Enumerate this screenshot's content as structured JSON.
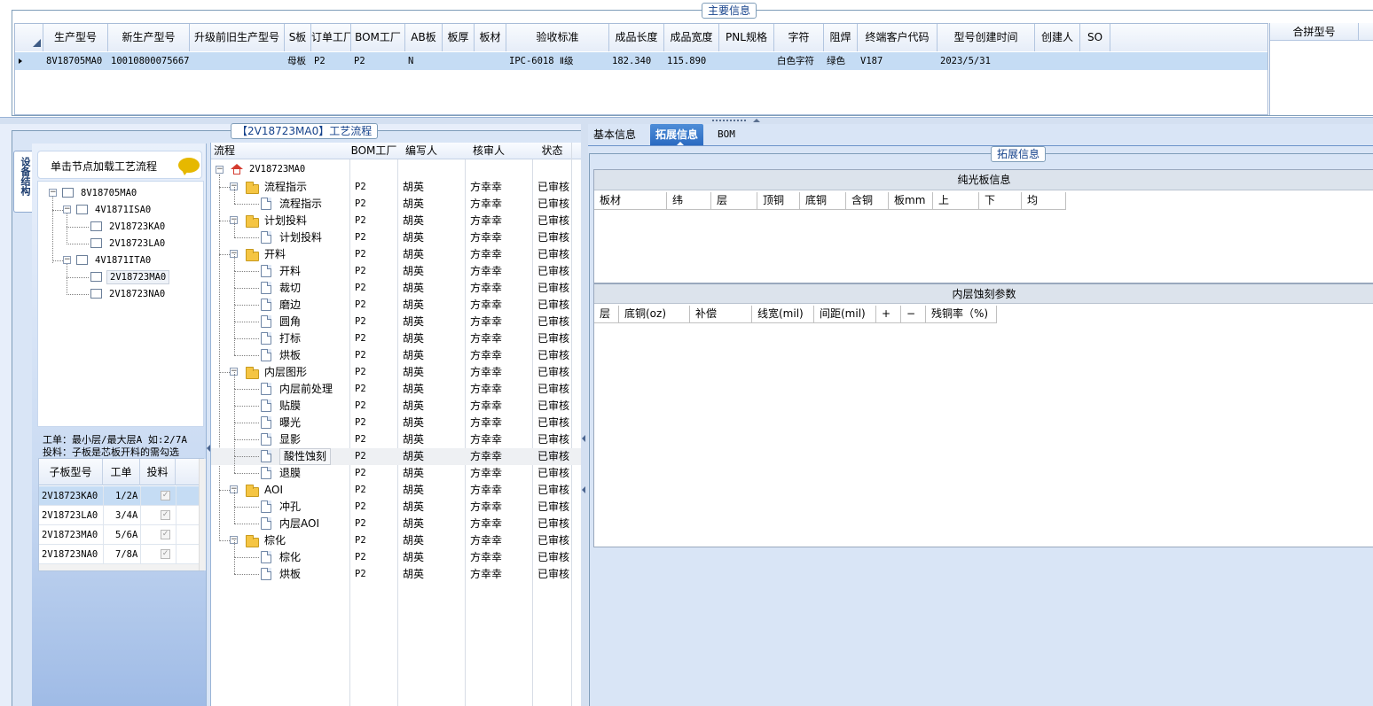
{
  "main_info": {
    "title": "主要信息",
    "columns": [
      "生产型号",
      "新生产型号",
      "升级前旧生产型号",
      "S板",
      "订单工厂",
      "BOM工厂",
      "AB板",
      "板厚",
      "板材",
      "验收标准",
      "成品长度",
      "成品宽度",
      "PNL规格",
      "字符",
      "阻焊",
      "终端客户代码",
      "型号创建时间",
      "创建人",
      "SO"
    ],
    "row": [
      "8V18705MA0",
      "10010800075667",
      "",
      "母板",
      "P2",
      "P2",
      "N",
      "",
      "",
      "IPC-6018 Ⅱ级",
      "182.340",
      "115.890",
      "",
      "白色字符",
      "绿色",
      "V187",
      "2023/5/31",
      "",
      ""
    ],
    "merge_header": "合拼型号"
  },
  "process_panel": {
    "title": "【2V18723MA0】工艺流程",
    "side_tab": "设备结构",
    "hint": "单击节点加载工艺流程",
    "tree": {
      "root": "8V18705MA0",
      "n1": "4V1871ISA0",
      "n1a": "2V18723KA0",
      "n1b": "2V18723LA0",
      "n2": "4V1871ITA0",
      "n2a": "2V18723MA0",
      "n2b": "2V18723NA0"
    },
    "note1": "工单：最小层/最大层A 如:2/7A",
    "note2": "投料：子板是芯板开料的需勾选",
    "sub_columns": [
      "子板型号",
      "工单",
      "投料"
    ],
    "sub_rows": [
      {
        "model": "2V18723KA0",
        "order": "1/2A"
      },
      {
        "model": "2V18723LA0",
        "order": "3/4A"
      },
      {
        "model": "2V18723MA0",
        "order": "5/6A"
      },
      {
        "model": "2V18723NA0",
        "order": "7/8A"
      }
    ],
    "flow_columns": [
      "流程",
      "BOM工厂",
      "编写人",
      "核审人",
      "状态"
    ],
    "flow_root": "2V18723MA0",
    "flow_rows": [
      {
        "name": "流程指示",
        "level": 1,
        "folder": true,
        "bom": "P2",
        "writer": "胡英",
        "reviewer": "方幸幸",
        "status": "已审核"
      },
      {
        "name": "流程指示",
        "level": 2,
        "folder": false,
        "bom": "P2",
        "writer": "胡英",
        "reviewer": "方幸幸",
        "status": "已审核"
      },
      {
        "name": "计划投料",
        "level": 1,
        "folder": true,
        "bom": "P2",
        "writer": "胡英",
        "reviewer": "方幸幸",
        "status": "已审核"
      },
      {
        "name": "计划投料",
        "level": 2,
        "folder": false,
        "bom": "P2",
        "writer": "胡英",
        "reviewer": "方幸幸",
        "status": "已审核"
      },
      {
        "name": "开料",
        "level": 1,
        "folder": true,
        "bom": "P2",
        "writer": "胡英",
        "reviewer": "方幸幸",
        "status": "已审核"
      },
      {
        "name": "开料",
        "level": 2,
        "folder": false,
        "bom": "P2",
        "writer": "胡英",
        "reviewer": "方幸幸",
        "status": "已审核"
      },
      {
        "name": "裁切",
        "level": 2,
        "folder": false,
        "bom": "P2",
        "writer": "胡英",
        "reviewer": "方幸幸",
        "status": "已审核"
      },
      {
        "name": "磨边",
        "level": 2,
        "folder": false,
        "bom": "P2",
        "writer": "胡英",
        "reviewer": "方幸幸",
        "status": "已审核"
      },
      {
        "name": "圆角",
        "level": 2,
        "folder": false,
        "bom": "P2",
        "writer": "胡英",
        "reviewer": "方幸幸",
        "status": "已审核"
      },
      {
        "name": "打标",
        "level": 2,
        "folder": false,
        "bom": "P2",
        "writer": "胡英",
        "reviewer": "方幸幸",
        "status": "已审核"
      },
      {
        "name": "烘板",
        "level": 2,
        "folder": false,
        "bom": "P2",
        "writer": "胡英",
        "reviewer": "方幸幸",
        "status": "已审核"
      },
      {
        "name": "内层图形",
        "level": 1,
        "folder": true,
        "bom": "P2",
        "writer": "胡英",
        "reviewer": "方幸幸",
        "status": "已审核"
      },
      {
        "name": "内层前处理",
        "level": 2,
        "folder": false,
        "bom": "P2",
        "writer": "胡英",
        "reviewer": "方幸幸",
        "status": "已审核"
      },
      {
        "name": "贴膜",
        "level": 2,
        "folder": false,
        "bom": "P2",
        "writer": "胡英",
        "reviewer": "方幸幸",
        "status": "已审核"
      },
      {
        "name": "曝光",
        "level": 2,
        "folder": false,
        "bom": "P2",
        "writer": "胡英",
        "reviewer": "方幸幸",
        "status": "已审核"
      },
      {
        "name": "显影",
        "level": 2,
        "folder": false,
        "bom": "P2",
        "writer": "胡英",
        "reviewer": "方幸幸",
        "status": "已审核"
      },
      {
        "name": "酸性蚀刻",
        "level": 2,
        "folder": false,
        "selected": true,
        "bom": "P2",
        "writer": "胡英",
        "reviewer": "方幸幸",
        "status": "已审核"
      },
      {
        "name": "退膜",
        "level": 2,
        "folder": false,
        "bom": "P2",
        "writer": "胡英",
        "reviewer": "方幸幸",
        "status": "已审核"
      },
      {
        "name": "AOI",
        "level": 1,
        "folder": true,
        "bom": "P2",
        "writer": "胡英",
        "reviewer": "方幸幸",
        "status": "已审核"
      },
      {
        "name": "冲孔",
        "level": 2,
        "folder": false,
        "bom": "P2",
        "writer": "胡英",
        "reviewer": "方幸幸",
        "status": "已审核"
      },
      {
        "name": "内层AOI",
        "level": 2,
        "folder": false,
        "bom": "P2",
        "writer": "胡英",
        "reviewer": "方幸幸",
        "status": "已审核"
      },
      {
        "name": "棕化",
        "level": 1,
        "folder": true,
        "bom": "P2",
        "writer": "胡英",
        "reviewer": "方幸幸",
        "status": "已审核"
      },
      {
        "name": "棕化",
        "level": 2,
        "folder": false,
        "bom": "P2",
        "writer": "胡英",
        "reviewer": "方幸幸",
        "status": "已审核"
      },
      {
        "name": "烘板",
        "level": 2,
        "folder": false,
        "bom": "P2",
        "writer": "胡英",
        "reviewer": "方幸幸",
        "status": "已审核"
      }
    ]
  },
  "detail_panel": {
    "tabs": [
      "基本信息",
      "拓展信息",
      "BOM"
    ],
    "active_tab": "拓展信息",
    "group_title": "拓展信息",
    "section1_title": "纯光板信息",
    "section1_columns": [
      "板材",
      "纬",
      "层",
      "顶铜",
      "底铜",
      "含铜",
      "板mm",
      "上",
      "下",
      "均"
    ],
    "section2_title": "内层蚀刻参数",
    "section2_columns": [
      "层",
      "底铜(oz)",
      "补偿",
      "线宽(mil)",
      "间距(mil)",
      "+",
      "−",
      "残铜率（%)"
    ]
  },
  "colors": {
    "selected_row": "#c5dcf4",
    "panel_bg": "#d9e5f6",
    "header_blue": "#15428b"
  }
}
